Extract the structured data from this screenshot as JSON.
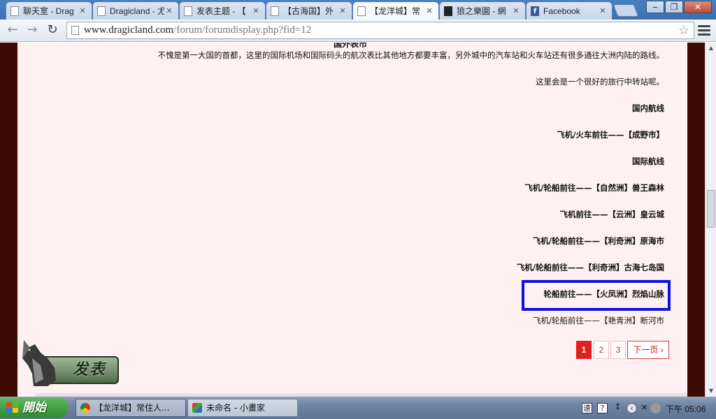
{
  "browser": {
    "tabs": [
      {
        "title": "聊天室 - Drag",
        "icon": "page-icon"
      },
      {
        "title": "Dragicland - 尤",
        "icon": "page-icon"
      },
      {
        "title": "发表主题 - 【",
        "icon": "page-icon"
      },
      {
        "title": "【古海国】外",
        "icon": "page-icon"
      },
      {
        "title": "【龙洋城】常",
        "icon": "page-icon"
      },
      {
        "title": "狼之樂園 - 網",
        "icon": "wolf-icon"
      },
      {
        "title": "Facebook",
        "icon": "facebook-icon"
      }
    ],
    "url_host": "www.dragicland.com",
    "url_path": "/forum/forumdisplay.php?fid=12"
  },
  "post": {
    "cut_title": "国外表市",
    "intro": "不愧是第一大国的首都，这里的国际机场和国际码头的航次表比其他地方都要丰富，另外城中的汽车站和火车站还有很多通往大洲内陆的路线。",
    "transit_note": "这里会是一个很好的旅行中转站呢。",
    "domestic_heading": "国内航线",
    "domestic_routes": [
      "飞机/火车前往——【成野市】"
    ],
    "international_heading": "国际航线",
    "international_routes": [
      "飞机/轮船前往——【自然洲】兽王森林",
      "飞机前往——【云洲】皇云城",
      "飞机/轮船前往——【利奇洲】原海市",
      "飞机/轮船前往——【利奇洲】古海七岛国",
      "轮船前往——【火凤洲】烈焰山脉",
      "飞机/轮船前往——【艳青洲】断河市"
    ]
  },
  "pagination": {
    "pages": [
      "1",
      "2",
      "3"
    ],
    "current": "1",
    "next_label": "下一页"
  },
  "post_button_label": "发表",
  "taskbar": {
    "start_label": "開始",
    "tasks": [
      {
        "label": "【龙洋城】常住人...",
        "icon": "chrome-icon"
      },
      {
        "label": "未命名 - 小畫家",
        "icon": "paint-icon"
      }
    ],
    "clock": "下午 05:06"
  },
  "colors": {
    "page_background": "#3e0a04",
    "panel": "#fff1f1",
    "highlight": "#0a10e6",
    "pager_active": "#e02020"
  }
}
